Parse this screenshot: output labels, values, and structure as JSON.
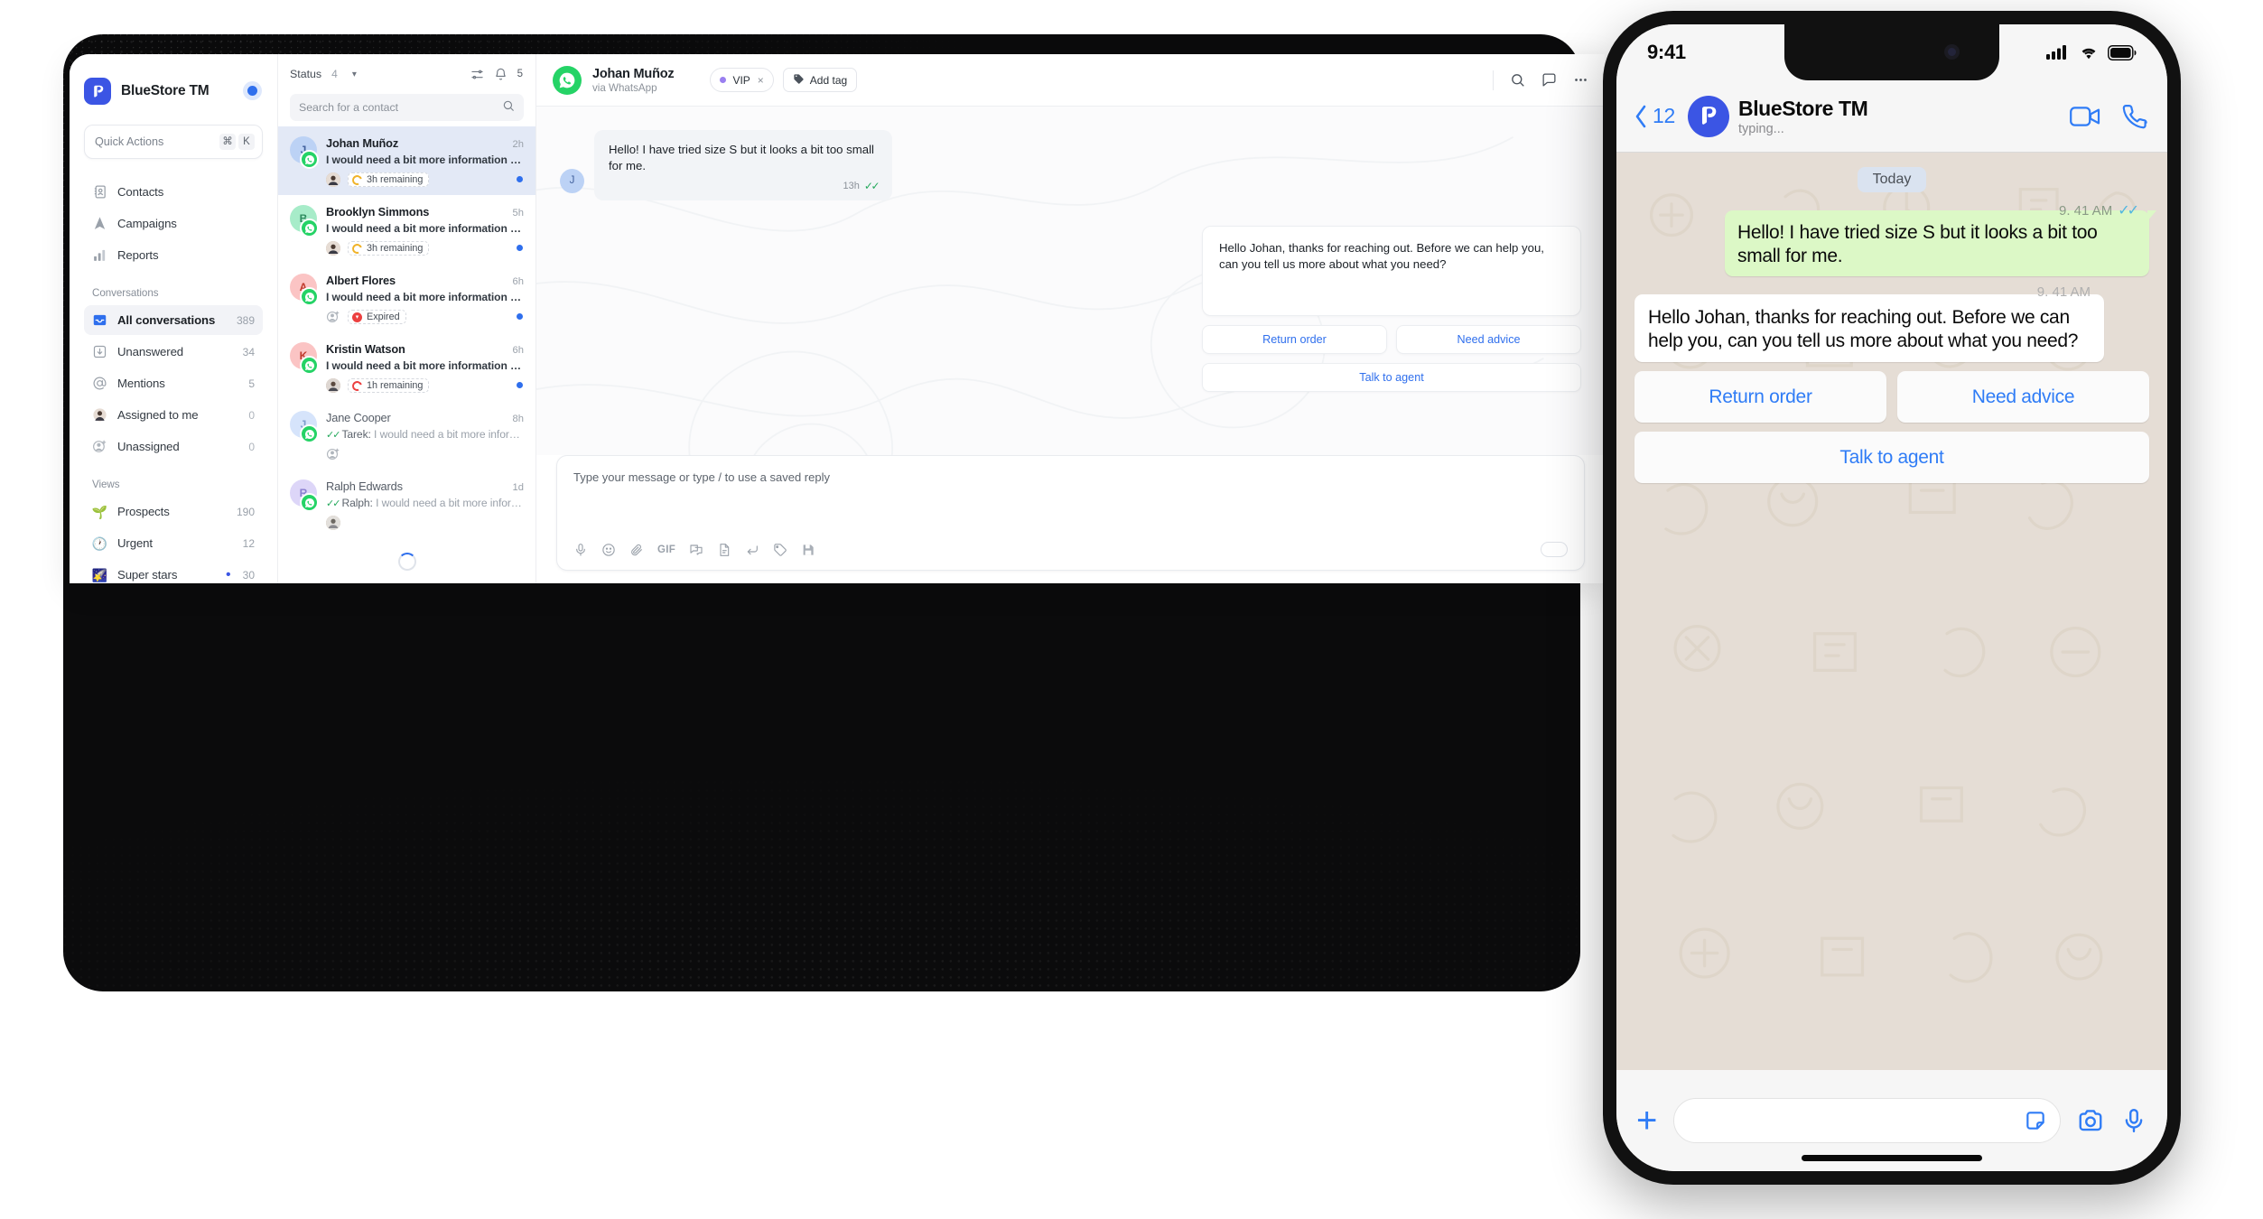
{
  "app": {
    "brand": {
      "name": "BlueStore TM",
      "logo_icon": "bluestore-logo-icon",
      "status_dot_color": "#2f6fed"
    },
    "quick_actions": {
      "label": "Quick Actions",
      "shortcut_keys": [
        "⌘",
        "K"
      ]
    },
    "sidebar": {
      "primary": [
        {
          "label": "Contacts",
          "icon": "contacts-book-icon",
          "count": ""
        },
        {
          "label": "Campaigns",
          "icon": "campaigns-send-icon",
          "count": ""
        },
        {
          "label": "Reports",
          "icon": "reports-bar-chart-icon",
          "count": ""
        }
      ],
      "conversations_header": "Conversations",
      "conversations": [
        {
          "label": "All conversations",
          "icon": "inbox-icon",
          "count": "389",
          "active": true
        },
        {
          "label": "Unanswered",
          "icon": "arrow-down-box-icon",
          "count": "34",
          "active": false
        },
        {
          "label": "Mentions",
          "icon": "at-mention-icon",
          "count": "5",
          "active": false
        },
        {
          "label": "Assigned to me",
          "icon": "user-avatar-icon",
          "count": "0",
          "active": false
        },
        {
          "label": "Unassigned",
          "icon": "user-plus-icon",
          "count": "0",
          "active": false
        }
      ],
      "views_header": "Views",
      "views": [
        {
          "label": "Prospects",
          "icon": "seedling-emoji-icon",
          "count": "190",
          "dot": false
        },
        {
          "label": "Urgent",
          "icon": "clock-emoji-icon",
          "count": "12",
          "dot": false
        },
        {
          "label": "Super stars",
          "icon": "shooting-star-emoji-icon",
          "count": "30",
          "dot": true
        }
      ]
    }
  },
  "conversation_list": {
    "status_label": "Status",
    "status_count": "4",
    "notification_count": "5",
    "search_placeholder": "Search for a contact",
    "items": [
      {
        "name": "Johan Muñoz",
        "initial": "J",
        "time": "2h",
        "preview": "I would need a bit more information if that's…",
        "sender": "",
        "ticks": false,
        "sla_label": "3h remaining",
        "sla_state": "orange",
        "assignee": "agent",
        "unread": true,
        "selected": true,
        "avatar_color": "#bcd2f5",
        "avatar_text_color": "#41609d"
      },
      {
        "name": "Brooklyn Simmons",
        "initial": "B",
        "time": "5h",
        "preview": "I would need a bit more information if that's…",
        "sender": "",
        "ticks": false,
        "sla_label": "3h remaining",
        "sla_state": "orange",
        "assignee": "agent",
        "unread": true,
        "selected": false,
        "avatar_color": "#a7ecc9",
        "avatar_text_color": "#2e8a5e"
      },
      {
        "name": "Albert Flores",
        "initial": "A",
        "time": "6h",
        "preview": "I would need a bit more information if that's…",
        "sender": "",
        "ticks": false,
        "sla_label": "Expired",
        "sla_state": "expired",
        "assignee": "unassigned",
        "unread": true,
        "selected": false,
        "avatar_color": "#fbc4c4",
        "avatar_text_color": "#c0392b"
      },
      {
        "name": "Kristin Watson",
        "initial": "K",
        "time": "6h",
        "preview": "I would need a bit more information if that's…",
        "sender": "",
        "ticks": false,
        "sla_label": "1h remaining",
        "sla_state": "red",
        "assignee": "agent",
        "unread": true,
        "selected": false,
        "avatar_color": "#fbc4c4",
        "avatar_text_color": "#c0392b"
      },
      {
        "name": "Jane Cooper",
        "initial": "J",
        "time": "8h",
        "preview": "I would need a bit more information…",
        "sender": "Tarek:",
        "ticks": true,
        "sla_label": "",
        "sla_state": "none",
        "assignee": "unassigned",
        "unread": false,
        "selected": false,
        "avatar_color": "#d6e4fb",
        "avatar_text_color": "#7d9ccd"
      },
      {
        "name": "Ralph Edwards",
        "initial": "R",
        "time": "1d",
        "preview": "I would need a bit more information…",
        "sender": "Ralph:",
        "ticks": true,
        "sla_label": "",
        "sla_state": "none",
        "assignee": "agent",
        "unread": false,
        "selected": false,
        "avatar_color": "#ddd6f8",
        "avatar_text_color": "#8b7fd0"
      }
    ]
  },
  "chat": {
    "contact_name": "Johan Muñoz",
    "channel": "via WhatsApp",
    "tag_pill": {
      "label": "VIP",
      "dot_color": "#9a7ff0",
      "close": "×"
    },
    "add_tag_label": "Add tag",
    "header_icons": [
      "search-icon",
      "note-icon",
      "more-icon"
    ],
    "messages": [
      {
        "direction": "in",
        "avatar_initial": "J",
        "text": "Hello! I have tried size S but it looks a bit too small for me.",
        "time": "13h",
        "ticks": true
      },
      {
        "direction": "out",
        "text": "Hello Johan, thanks for reaching out. Before we can help you, can you tell us more about what you need?",
        "time": "",
        "ticks": false
      }
    ],
    "quick_replies": [
      "Return order",
      "Need advice",
      "Talk to agent"
    ],
    "composer": {
      "placeholder": "Type your message or type / to use a saved reply",
      "tools": [
        "microphone-icon",
        "emoji-icon",
        "attachment-icon",
        "gif-icon",
        "saved-reply-icon",
        "document-icon",
        "signature-icon",
        "tag-icon",
        "save-icon"
      ],
      "gif_label": "GIF"
    }
  },
  "phone": {
    "status_bar": {
      "time": "9:41",
      "icons": [
        "cellular-signal-icon",
        "wifi-icon",
        "battery-icon"
      ]
    },
    "header": {
      "back_count": "12",
      "name": "BlueStore TM",
      "presence": "typing...",
      "icons": [
        "video-call-icon",
        "voice-call-icon"
      ]
    },
    "day_divider": "Today",
    "messages": [
      {
        "direction": "out",
        "text": "Hello! I have tried size S but it looks a bit too small for me.",
        "time": "9. 41 AM",
        "ticks": true
      },
      {
        "direction": "in",
        "text": "Hello Johan, thanks for reaching out. Before we can help you, can you tell us more about what you need?",
        "time": "9. 41 AM",
        "ticks": false
      }
    ],
    "quick_replies": [
      "Return order",
      "Need advice",
      "Talk to agent"
    ],
    "footer": {
      "plus": "+",
      "input_placeholder": "",
      "icons": [
        "sticker-icon",
        "camera-icon",
        "microphone-icon"
      ]
    }
  },
  "colors": {
    "brand_blue": "#3b55e4",
    "accent_blue": "#2f6fed",
    "whatsapp_green": "#25d366",
    "ios_blue": "#2f7cf6",
    "bubble_green": "#dcf8c6",
    "selected_row": "#e3e9f6"
  }
}
